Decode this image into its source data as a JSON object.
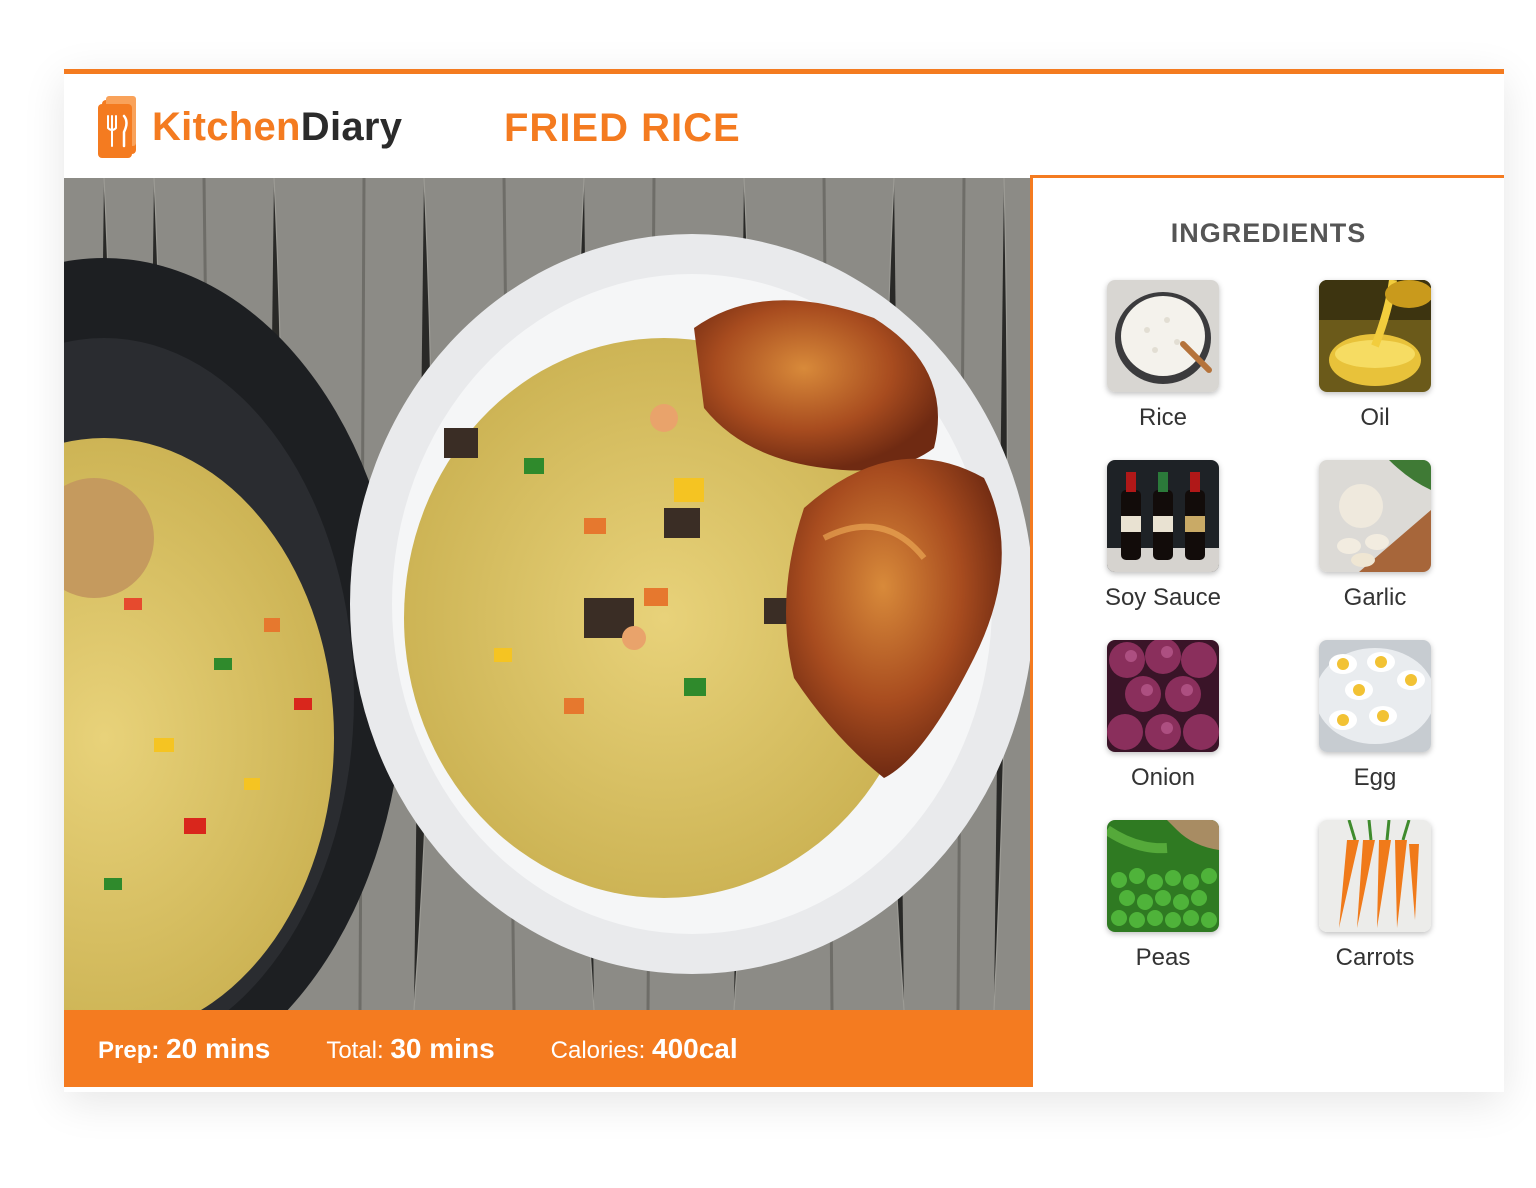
{
  "brand": {
    "part1": "Kitchen",
    "part2": "Diary",
    "accent_color": "#f47b20",
    "icon": "recipe-book-icon"
  },
  "recipe": {
    "title": "FRIED RICE"
  },
  "photo": {
    "subject": "fried-rice-dish-photo"
  },
  "stats": {
    "prep_label": "Prep:",
    "prep_value": "20 mins",
    "total_label": "Total:",
    "total_value": "30 mins",
    "calories_label": "Calories:",
    "calories_value": "400cal"
  },
  "ingredients": {
    "title": "INGREDIENTS",
    "items": [
      {
        "name": "Rice"
      },
      {
        "name": "Oil"
      },
      {
        "name": "Soy Sauce"
      },
      {
        "name": "Garlic"
      },
      {
        "name": "Onion"
      },
      {
        "name": "Egg"
      },
      {
        "name": "Peas"
      },
      {
        "name": "Carrots"
      }
    ]
  }
}
